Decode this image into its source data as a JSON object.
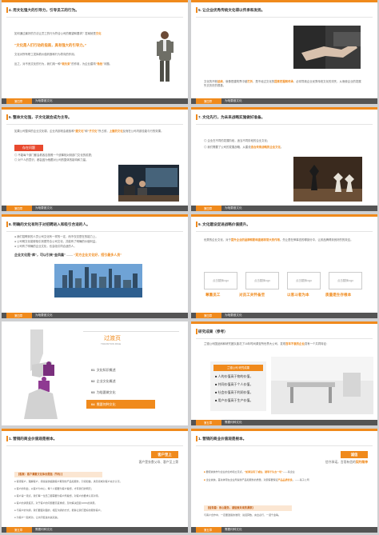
{
  "slides": [
    {
      "heading": "4. 用文化强大的引导力，引导员工的行为。",
      "line1": "如何通过最好的方法让员工的行为符合公司的期望和要求？答案就是",
      "line1_em": "文化",
      "big": "“文化是人们行动的指南，具有强大的引导力。”",
      "line2": "文化对所有职工发挥着价值判断和行为导向的作用。",
      "line3": "反之，对不良文化的行为，我们用一种",
      "line3_em": "“软约束”",
      "line3_b": "的作用，为企业建构",
      "line3_em2": "“角色”",
      "line3_c": "问题。",
      "footer_part": "第四章",
      "footer_title": "为啥要做文化"
    },
    {
      "heading": "5. 让企业优秀传统文化得以传承和发扬。",
      "p1": "文化的不断",
      "p1_em": "延续",
      "p1_b": "，就像是建筑界中被",
      "p1_em2": "打折",
      "p1_c": "，是不经过文化的",
      "p1_em3": "提炼挖掘和传承",
      "p1_d": "，必将导致企业优秀传统文化的流失，从而使企业的发展失去历史的根基。",
      "footer_part": "第四章",
      "footer_title": "为啥要做文化"
    },
    {
      "heading": "6. 整体文化强，子文化就会成为主导。",
      "p1": "如果公司整体的企业文化弱，企业内部则会被各种",
      "p1_em": "“潜文化”",
      "p1_b": "和",
      "p1_em2": "“子文化”",
      "p1_c": "所占领，",
      "p1_em3": "上面的文化",
      "p1_d": "反而在公司内部没能与行的效果。",
      "tag": "存在问题",
      "item1": "不能每个部门都会着各自按照一个统筹相对到部门文化的前提；",
      "item2": "对个人的意识，都会因为他跟对公司的整体的影响和力量。",
      "footer_part": "第四章",
      "footer_title": "为啥要做文化"
    },
    {
      "heading": "7. 文化先行，为未来战略实施做好准备。",
      "item1": "企业在不同的发展阶段，适当不同阶段的企业文化；",
      "item2": "我们需要了公司的发展战略，从建设",
      "item2_em": "适合未来战略的企业文化",
      "item2_b": "。",
      "footer_part": "第四章",
      "footer_title": "为啥要做文化"
    },
    {
      "heading": "8. 明确的文化有利于对招聘进入和吸引合适的人。",
      "items": [
        "我们招聘到的人员公司文化有一样的一定，而不仅仅是在的能力上。",
        "公司明文化能够吸引到更符合公司文化，并能有了明确的价值利益。",
        "公司有了明确的企业文化，也会吸引同合适的人。"
      ],
      "slogan": "企业文化是“库”，可以引来“金凤凰”",
      "slogan_dash": "——",
      "slogan_em": "“双方企业文化好，招引最多人员”",
      "footer_part": "第四章",
      "footer_title": "为啥要做文化"
    },
    {
      "heading": "9. 文化建设促进战略价值提升。",
      "p1": "优秀的企业文化，对于",
      "p1_em": "提升企业的品牌和影响度都非常大的作用",
      "p1_b": "。先让是在伸事态的哪部分中，让其品牌得到良好的的效应。",
      "img_label": "点击替换logo",
      "values": [
        "尊重员工",
        "对员工关怀备至",
        "以客斗者为本",
        "质量是生存根本"
      ],
      "footer_part": "第四章",
      "footer_title": "为啥要做文化"
    },
    {
      "transition": "过渡页",
      "transition_en": "TRANSITION PAGE",
      "toc": [
        {
          "num": "01",
          "label": "文化知识概述"
        },
        {
          "num": "02",
          "label": "企业文化概述"
        },
        {
          "num": "03",
          "label": "为啥要做文化"
        },
        {
          "num": "04",
          "label": "需要何种文化"
        }
      ]
    },
    {
      "heading": "研究成果（参考）",
      "p1": "兰德公司国品斜和研究团队曾花了16年时间调查所世界大公司，发现",
      "p1_em": "百年不衰的企业",
      "p1_b": "具有一个共同特征：",
      "box_title": "兰德公司 研究成果",
      "box_items": [
        "人的价值高于物的价值，",
        "共同价值高于个人价值，",
        "社会价值高于利润价值，",
        "用户价值高于生产价值。"
      ],
      "footer_part": "第五章",
      "footer_title": "需要何种文化"
    },
    {
      "heading": "1. 营销的商业价值观是根本。",
      "badge": "客户至上",
      "sub": "客户是衣食父母、客户至上第",
      "bar": "【客案：客户满意文化体合是指（节约）】",
      "items": [
        "客观客户，理解客户，持续提供超越客户期望的产品和服务，引领和做，满足领域对客户充分认可。",
        "客户的利益，以客户为中心，每个人都要为客户着想，才有我们的明天；",
        "客户第一观点，我们每一位员工都需要为客户所着想，对客户的要求认真对待。",
        "客户的满意度高，对于客户的问题要高度重视，及时解决回复100%的满意。",
        "与客户的沟通，我们要面对面的、相互沟通的方式，能够让我们更好的服务客户。",
        "为客户一起成功，让共同促进共赢双赢。"
      ],
      "footer_part": "第五章",
      "footer_title": "需要何种文化"
    },
    {
      "heading": "1. 营销的商业价值观是根本。",
      "badge": "诚信",
      "sub": "信守承诺，言而有信的",
      "sub_em": "契约精神",
      "item1": "要把诚信作为企业的生命和立足点，",
      "item1_em": "“如果没有了诚信，就等于失去一切”",
      "item1_b": "——某企业",
      "item2": "企业诚信，首先体现在企业所提供产品和服务的质量，对顾客要保证",
      "item2_em": "产品品质优良",
      "item2_b": "。——某子公司",
      "bar": "【信条篇：用心服务，诚信致未来的源泉】",
      "last": "与客户合作中，一定要遵循的准则：说话算数，言出必行，一诺千金等。",
      "footer_part": "第五章",
      "footer_title": "需要何种文化"
    }
  ],
  "colors": {
    "accent": "#f08a1c",
    "dark_bar": "#545454",
    "blue": "#3b82c4"
  }
}
